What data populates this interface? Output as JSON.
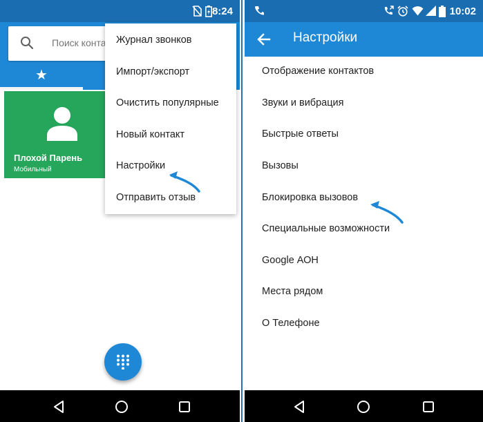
{
  "left": {
    "status": {
      "time": "8:24"
    },
    "search": {
      "placeholder": "Поиск конта"
    },
    "contact": {
      "name": "Плохой Парень",
      "type": "Мобильный"
    },
    "menu": {
      "items": [
        "Журнал звонков",
        "Импорт/экспорт",
        "Очистить популярные",
        "Новый контакт",
        "Настройки",
        "Отправить отзыв"
      ]
    }
  },
  "right": {
    "status": {
      "time": "10:02"
    },
    "title": "Настройки",
    "items": [
      "Отображение контактов",
      "Звуки и вибрация",
      "Быстрые ответы",
      "Вызовы",
      "Блокировка вызовов",
      "Специальные возможности",
      "Google АОН",
      "Места рядом",
      "О Телефоне"
    ]
  },
  "icons": {
    "left_status": [
      "no-sim-icon",
      "battery-charging-icon"
    ],
    "right_status": [
      "phone-icon",
      "call-forward-icon",
      "alarm-icon",
      "wifi-icon",
      "signal-icon",
      "battery-icon"
    ],
    "nav": [
      "back-icon",
      "home-icon",
      "recents-icon"
    ],
    "fab": "dialpad-icon",
    "tab": "star-icon",
    "app_bar": "back-arrow-icon"
  },
  "colors": {
    "primary": "#1e88d6",
    "status_bar": "#1a6db0",
    "contact_tile": "#26a65b",
    "nav_bar": "#000000",
    "annotation": "#1e88d6"
  }
}
